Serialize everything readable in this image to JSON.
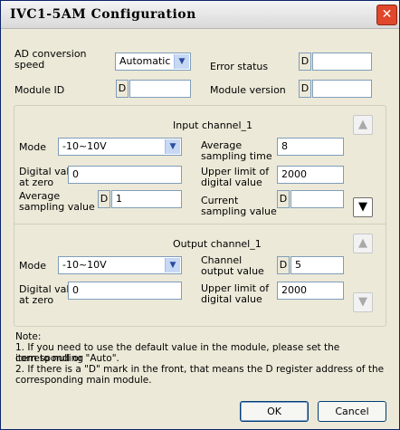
{
  "window": {
    "title": "IVC1-5AM Configuration",
    "close_glyph": "✕"
  },
  "top": {
    "ad_label": "AD conversion\nspeed",
    "ad_value": "Automatic",
    "error_label": "Error status",
    "error_value": "",
    "module_id_label": "Module ID",
    "module_id_value": "",
    "module_version_label": "Module version",
    "module_version_value": "",
    "d_mark": "D"
  },
  "input": {
    "title": "Input channel_1",
    "mode_label": "Mode",
    "mode_value": "-10~10V",
    "avg_time_label": "Average\nsampling time",
    "avg_time_value": "8",
    "digital_zero_label": "Digital value\nat zero",
    "digital_zero_value": "0",
    "upper_limit_label": "Upper limit of\ndigital value",
    "upper_limit_value": "2000",
    "avg_value_label": "Average\nsampling value",
    "avg_value_value": "1",
    "current_value_label": "Current\nsampling value",
    "current_value_value": "",
    "up_icon": "▲",
    "down_icon": "▼"
  },
  "output": {
    "title": "Output channel_1",
    "mode_label": "Mode",
    "mode_value": "-10~10V",
    "channel_output_label": "Channel\noutput value",
    "channel_output_value": "5",
    "digital_zero_label": "Digital value\nat zero",
    "digital_zero_value": "0",
    "upper_limit_label": "Upper limit of\ndigital value",
    "upper_limit_value": "2000",
    "up_icon": "▲",
    "down_icon": "▼"
  },
  "note": {
    "heading": "Note:",
    "line1": "1. If you need to use the default value in the module, please set the corresponding",
    "line1b": "item to null or \"Auto\".",
    "line2": "2. If there is a \"D\" mark in the front, that means the D register address of the",
    "line2b": "corresponding main module."
  },
  "buttons": {
    "ok": "OK",
    "cancel": "Cancel"
  },
  "icons": {
    "dropdown": "chevron-down-icon"
  }
}
